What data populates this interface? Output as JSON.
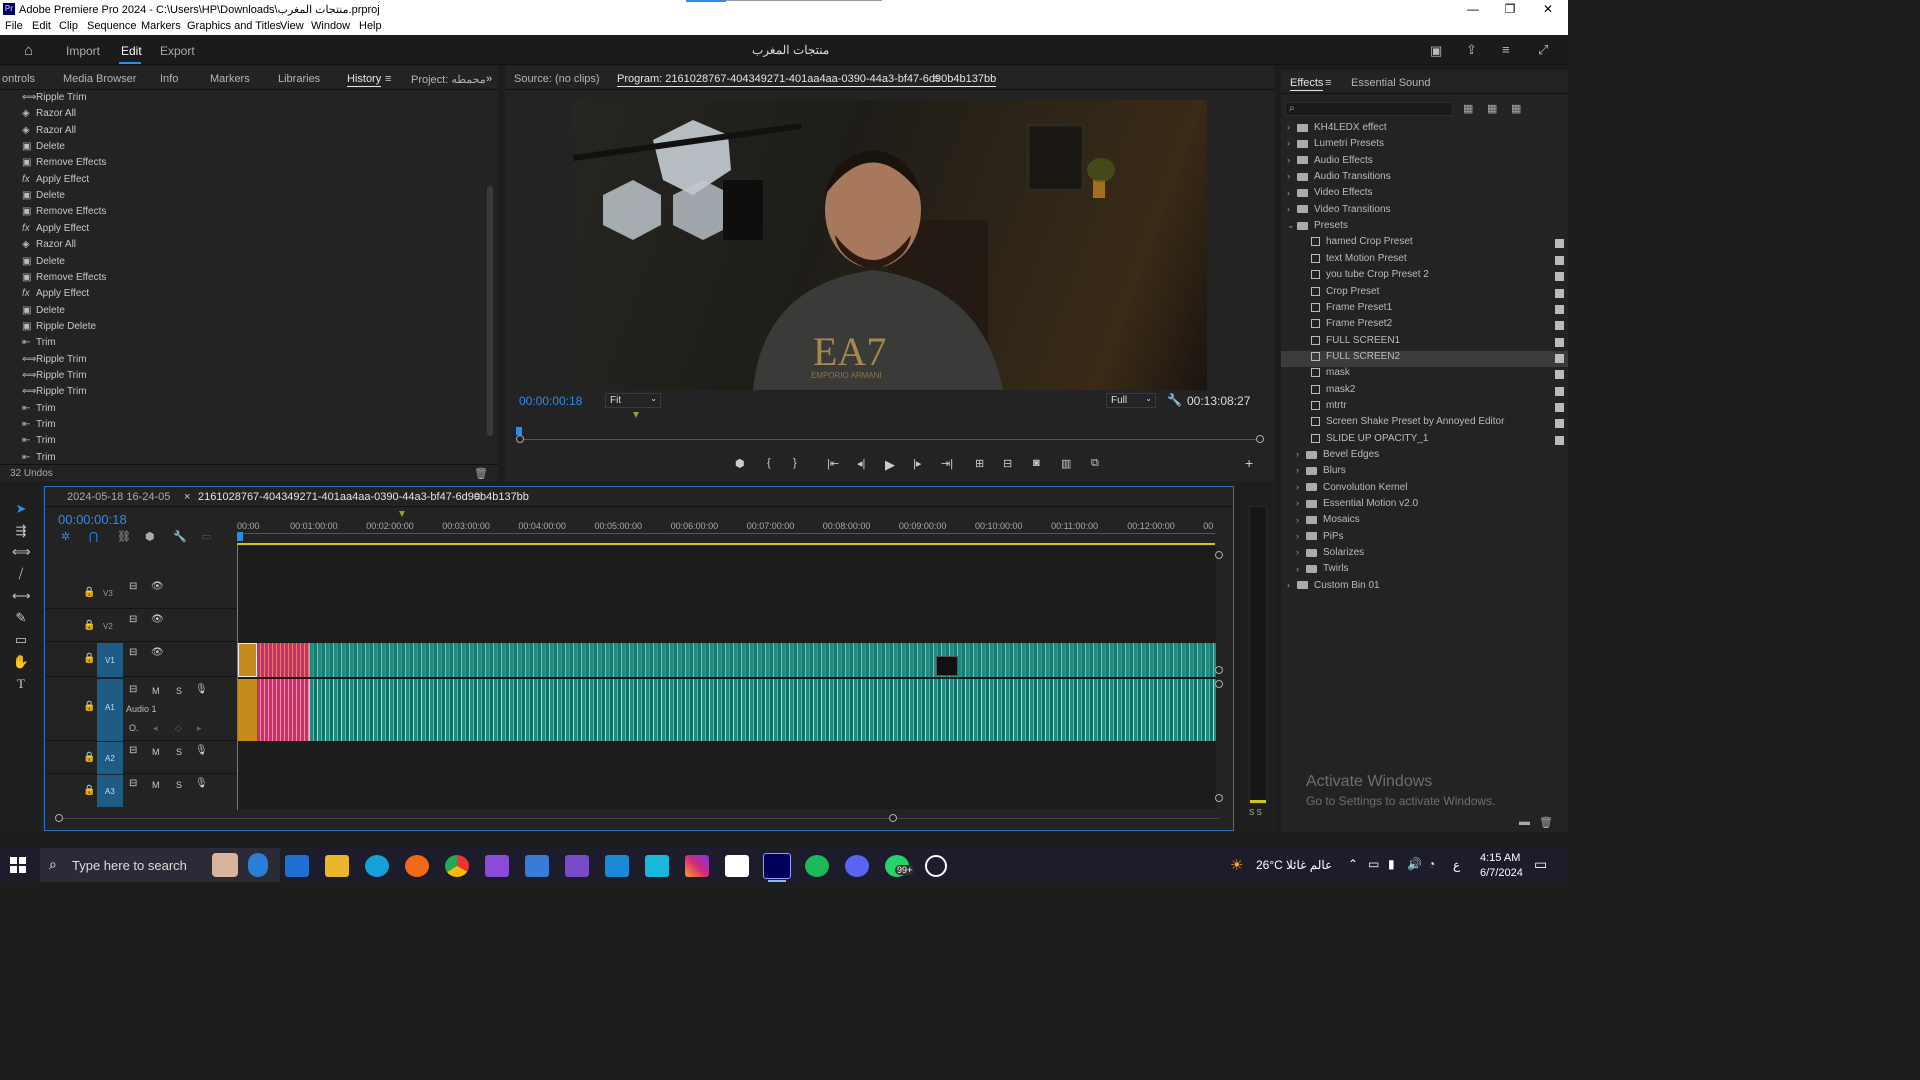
{
  "titlebar": {
    "app_icon": "Pr",
    "title": "Adobe Premiere Pro 2024 - C:\\Users\\HP\\Downloads\\منتجات المغرب.prproj"
  },
  "menu": [
    "File",
    "Edit",
    "Clip",
    "Sequence",
    "Markers",
    "Graphics and Titles",
    "View",
    "Window",
    "Help"
  ],
  "header": {
    "tabs": [
      "Import",
      "Edit",
      "Export"
    ],
    "active_tab": "Edit",
    "project_title": "منتجات المغرب"
  },
  "left_panel": {
    "tabs": [
      "ontrols",
      "Media Browser",
      "Info",
      "Markers",
      "Libraries",
      "History",
      "Project: محمطه"
    ],
    "active_tab": "History",
    "history": [
      {
        "icon": "ripple-trim-icon",
        "label": "Ripple Trim"
      },
      {
        "icon": "razor-icon",
        "label": "Razor All"
      },
      {
        "icon": "razor-icon",
        "label": "Razor All"
      },
      {
        "icon": "history-icon",
        "label": "Delete"
      },
      {
        "icon": "history-icon",
        "label": "Remove Effects"
      },
      {
        "icon": "fx-icon",
        "label": "Apply Effect"
      },
      {
        "icon": "history-icon",
        "label": "Delete"
      },
      {
        "icon": "history-icon",
        "label": "Remove Effects"
      },
      {
        "icon": "fx-icon",
        "label": "Apply Effect"
      },
      {
        "icon": "razor-icon",
        "label": "Razor All"
      },
      {
        "icon": "history-icon",
        "label": "Delete"
      },
      {
        "icon": "history-icon",
        "label": "Remove Effects"
      },
      {
        "icon": "fx-icon",
        "label": "Apply Effect"
      },
      {
        "icon": "history-icon",
        "label": "Delete"
      },
      {
        "icon": "history-icon",
        "label": "Ripple Delete"
      },
      {
        "icon": "trim-icon",
        "label": "Trim"
      },
      {
        "icon": "ripple-trim-icon",
        "label": "Ripple Trim"
      },
      {
        "icon": "ripple-trim-icon",
        "label": "Ripple Trim"
      },
      {
        "icon": "ripple-trim-icon",
        "label": "Ripple Trim"
      },
      {
        "icon": "trim-icon",
        "label": "Trim"
      },
      {
        "icon": "trim-icon",
        "label": "Trim"
      },
      {
        "icon": "trim-icon",
        "label": "Trim"
      },
      {
        "icon": "trim-icon",
        "label": "Trim"
      }
    ],
    "undos": "32 Undos"
  },
  "monitor": {
    "source_tab": "Source: (no clips)",
    "program_tab": "Program: 2161028767-404349271-401aa4aa-0390-44a3-bf47-6d90b4b137bb",
    "timecode": "00:00:00:18",
    "fit": "Fit",
    "quality": "Full",
    "duration": "00:13:08:27"
  },
  "effects": {
    "tabs": [
      "Effects",
      "Essential Sound"
    ],
    "search_placeholder": "",
    "items": [
      {
        "level": 0,
        "type": "folder",
        "label": "KH4LEDX effect"
      },
      {
        "level": 0,
        "type": "folder",
        "label": "Lumetri Presets"
      },
      {
        "level": 0,
        "type": "folder",
        "label": "Audio Effects"
      },
      {
        "level": 0,
        "type": "folder",
        "label": "Audio Transitions"
      },
      {
        "level": 0,
        "type": "folder",
        "label": "Video Effects"
      },
      {
        "level": 0,
        "type": "folder",
        "label": "Video Transitions"
      },
      {
        "level": 0,
        "type": "folder-open",
        "label": "Presets"
      },
      {
        "level": 1,
        "type": "preset",
        "label": "hamed Crop Preset"
      },
      {
        "level": 1,
        "type": "preset",
        "label": "text Motion Preset"
      },
      {
        "level": 1,
        "type": "preset",
        "label": "you tube Crop Preset 2"
      },
      {
        "level": 1,
        "type": "preset",
        "label": "Crop Preset"
      },
      {
        "level": 1,
        "type": "preset",
        "label": "Frame Preset1"
      },
      {
        "level": 1,
        "type": "preset",
        "label": "Frame Preset2"
      },
      {
        "level": 1,
        "type": "preset",
        "label": "FULL SCREEN1"
      },
      {
        "level": 1,
        "type": "preset",
        "label": "FULL SCREEN2",
        "selected": true
      },
      {
        "level": 1,
        "type": "preset",
        "label": "mask"
      },
      {
        "level": 1,
        "type": "preset",
        "label": "mask2"
      },
      {
        "level": 1,
        "type": "preset",
        "label": "mtrtr"
      },
      {
        "level": 1,
        "type": "preset",
        "label": "Screen Shake Preset by Annoyed Editor"
      },
      {
        "level": 1,
        "type": "preset",
        "label": "SLIDE UP OPACITY_1"
      },
      {
        "level": 1,
        "type": "folder",
        "label": "Bevel Edges"
      },
      {
        "level": 1,
        "type": "folder",
        "label": "Blurs"
      },
      {
        "level": 1,
        "type": "folder",
        "label": "Convolution Kernel"
      },
      {
        "level": 1,
        "type": "folder",
        "label": "Essential Motion v2.0"
      },
      {
        "level": 1,
        "type": "folder",
        "label": "Mosaics"
      },
      {
        "level": 1,
        "type": "folder",
        "label": "PiPs"
      },
      {
        "level": 1,
        "type": "folder",
        "label": "Solarizes"
      },
      {
        "level": 1,
        "type": "folder",
        "label": "Twirls"
      },
      {
        "level": 0,
        "type": "folder",
        "label": "Custom Bin 01"
      }
    ]
  },
  "timeline": {
    "tabs": [
      "2024-05-18 16-24-05",
      "2161028767-404349271-401aa4aa-0390-44a3-bf47-6d90b4b137bb"
    ],
    "timecode": "00:00:00:18",
    "ruler": [
      "00:00",
      "00:01:00:00",
      "00:02:00:00",
      "00:03:00:00",
      "00:04:00:00",
      "00:05:00:00",
      "00:06:00:00",
      "00:07:00:00",
      "00:08:00:00",
      "00:09:00:00",
      "00:10:00:00",
      "00:11:00:00",
      "00:12:00:00",
      "00"
    ],
    "tracks": {
      "v3": "V3",
      "v2": "V2",
      "v1": "V1",
      "a1": "A1",
      "a1_name": "Audio 1",
      "a2": "A2",
      "a3": "A3",
      "m": "M",
      "s": "S"
    },
    "audio_meter": "S S"
  },
  "watermark": {
    "line1": "Activate Windows",
    "line2": "Go to Settings to activate Windows."
  },
  "taskbar": {
    "search_placeholder": "Type here to search",
    "weather": "26°C",
    "weather_text": "عالم غائلا",
    "lang": "ع",
    "time": "4:15 AM",
    "date": "6/7/2024",
    "whatsapp_badge": "99+"
  },
  "colors": {
    "accent": "#2d8ceb",
    "clip_teal": "#1e8a80",
    "clip_pink": "#c2336b",
    "clip_orange": "#c58a1a",
    "playhead_yellow": "#d6c31a"
  }
}
